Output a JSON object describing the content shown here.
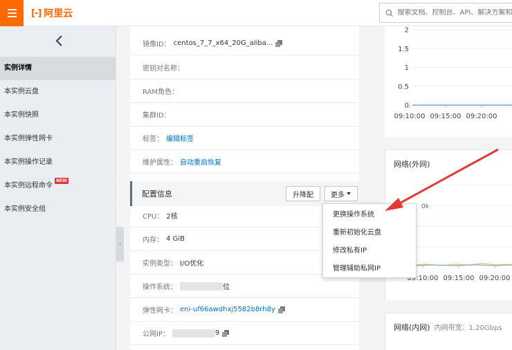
{
  "brand": {
    "logo_mark": "[-]",
    "logo_text": "阿里云",
    "accent_color": "#ff6a00"
  },
  "search": {
    "placeholder": "搜索文档、控制台、API、解决方案和资源"
  },
  "sidebar": {
    "items": [
      {
        "label": "实例详情",
        "active": true
      },
      {
        "label": "本实例云盘"
      },
      {
        "label": "本实例快照"
      },
      {
        "label": "本实例弹性网卡"
      },
      {
        "label": "本实例操作记录"
      },
      {
        "label": "本实例远程命令",
        "badge": "NEW"
      },
      {
        "label": "本实例安全组"
      }
    ]
  },
  "basic_info": {
    "image_label": "镜像ID：",
    "image_value": "centos_7_7_x64_20G_aliba...",
    "keypair_label": "密钥对名称：",
    "ram_label": "RAM角色：",
    "cluster_label": "集群ID：",
    "tags_label": "标签：",
    "tags_link": "编辑标签",
    "maintenance_label": "维护属性：",
    "maintenance_link": "自动重启恢复"
  },
  "config": {
    "title": "配置信息",
    "upgrade_button": "升降配",
    "more_button": "更多",
    "cpu_label": "CPU：",
    "cpu_value": "2核",
    "memory_label": "内存：",
    "memory_value": "4 GiB",
    "type_label": "实例类型：",
    "type_value": "I/O优化",
    "os_label": "操作系统：",
    "os_suffix": "位",
    "eni_label": "弹性网卡：",
    "eni_value": "eni-uf66awdhxj5582b8rh8y",
    "public_ip_label": "公网IP：",
    "public_ip_suffix": "9"
  },
  "more_menu": {
    "items": [
      "更换操作系统",
      "重新初始化云盘",
      "修改私有IP",
      "管理辅助私网IP"
    ]
  },
  "charts": {
    "network_external_title": "网络(外网)",
    "network_internal_title": "网络(内网)",
    "network_internal_sub": "内网带宽：1.20Gbps"
  },
  "chart_data": [
    {
      "type": "line",
      "title": "",
      "x": [
        "09:10:00",
        "09:15:00",
        "09:20:00"
      ],
      "y_ticks": [
        0,
        0.5,
        1,
        1.5,
        2
      ],
      "series": [
        {
          "values": [
            0,
            0,
            0
          ]
        }
      ],
      "color": "#4a90e2"
    },
    {
      "type": "line",
      "title": "网络(外网)",
      "x": [
        "09:10:00",
        "09:15:00",
        "09:20:00"
      ],
      "y_ticks_visible": [
        "0k"
      ],
      "series": [
        {
          "values": [
            0,
            0,
            0
          ]
        },
        {
          "values": [
            0,
            0,
            0
          ]
        }
      ],
      "colors": [
        "#f5c242",
        "#7fb2e5"
      ]
    }
  ]
}
